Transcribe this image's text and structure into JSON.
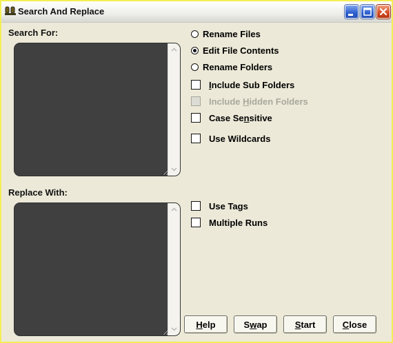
{
  "window": {
    "title": "Search And Replace",
    "title_icon": "app-icon"
  },
  "search": {
    "label": "Search For:",
    "value": ""
  },
  "replace": {
    "label": "Replace With:",
    "value": ""
  },
  "mode_options": [
    {
      "label": "Rename Files",
      "checked": false
    },
    {
      "label": "Edit File Contents",
      "checked": true
    },
    {
      "label": "Rename Folders",
      "checked": false
    }
  ],
  "checkboxes": {
    "include_sub_folders": {
      "pre": "",
      "ul": "I",
      "post": "nclude Sub Folders",
      "checked": false,
      "enabled": true
    },
    "include_hidden_folders": {
      "pre": "Include ",
      "ul": "H",
      "post": "idden Folders",
      "checked": false,
      "enabled": false
    },
    "case_sensitive": {
      "pre": "Case Se",
      "ul": "n",
      "post": "sitive",
      "checked": false,
      "enabled": true
    },
    "use_wildcards": {
      "pre": "Use Wildcards",
      "ul": "",
      "post": "",
      "checked": false,
      "enabled": true
    },
    "use_tags": {
      "pre": "Use Tags",
      "ul": "",
      "post": "",
      "checked": false,
      "enabled": true
    },
    "multiple_runs": {
      "pre": "Multiple Runs",
      "ul": "",
      "post": "",
      "checked": false,
      "enabled": true
    }
  },
  "buttons": {
    "help": {
      "ul": "H",
      "rest": "elp"
    },
    "swap": {
      "pre": "S",
      "ul": "w",
      "rest": "ap"
    },
    "start": {
      "ul": "S",
      "rest": "tart"
    },
    "close": {
      "ul": "C",
      "rest": "lose"
    }
  },
  "colors": {
    "window_bg": "#ece9d8",
    "textarea_bg": "#404040",
    "frame_border": "#f3ef55"
  }
}
